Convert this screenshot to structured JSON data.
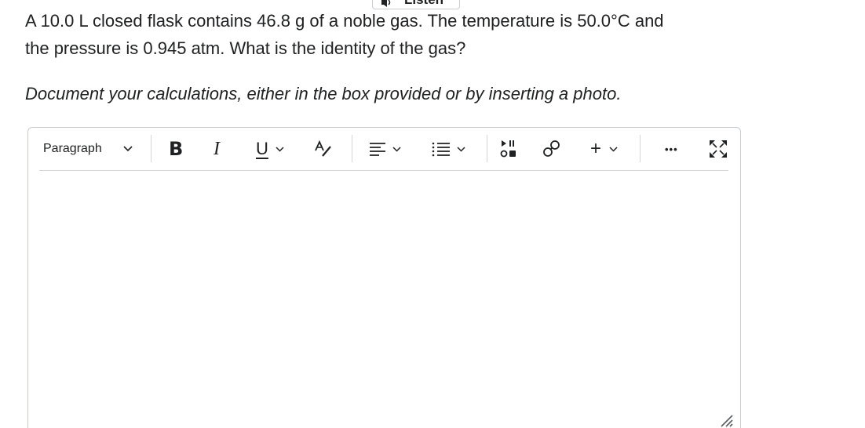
{
  "listen": {
    "label": "Listen",
    "icon": "speaker-icon"
  },
  "question": {
    "line1": "A 10.0 L closed flask contains 46.8 g of a noble gas.  The temperature is 50.0°C and",
    "line2": "the pressure is 0.945 atm.  What is the identity of the gas?"
  },
  "instruction": "Document your calculations, either in the box provided or by inserting a photo.",
  "editor": {
    "toolbar": {
      "format_select": "Paragraph",
      "bold": "B",
      "italic": "I",
      "underline": "U",
      "insert": "+",
      "more": "•••",
      "icons": {
        "format_dropdown": "chevron-down-icon",
        "text_style": "text-color-icon",
        "align": "align-left-icon",
        "list": "list-icon",
        "media": "insert-media-icon",
        "link": "link-icon",
        "insert": "plus-icon",
        "more": "more-options-icon",
        "fullscreen": "fullscreen-icon"
      }
    },
    "content": "",
    "resize_handle": "resize-handle-icon"
  }
}
